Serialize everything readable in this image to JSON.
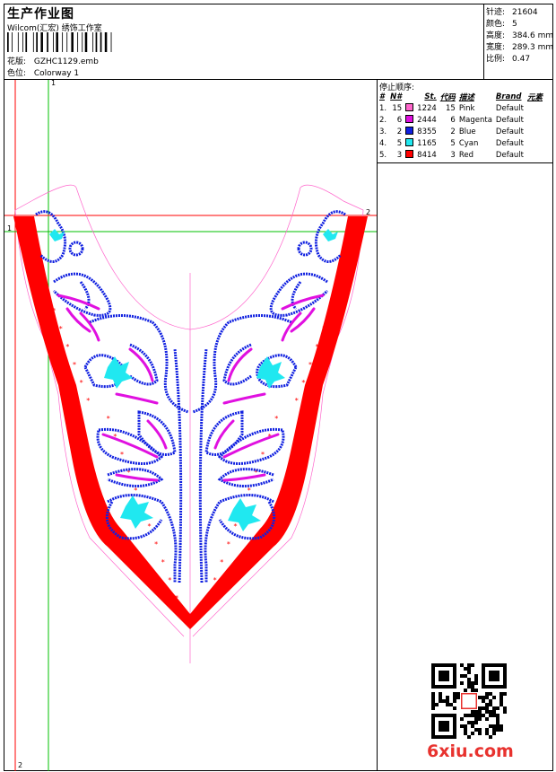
{
  "header": {
    "title": "生产作业图",
    "company": "Wilcom(汇宏) 绣饰工作室",
    "design_label": "花版:",
    "design_value": "GZHC1129.emb",
    "colorway_label": "色位:",
    "colorway_value": "Colorway 1"
  },
  "stats": [
    {
      "label": "针迹:",
      "value": "21604"
    },
    {
      "label": "颜色:",
      "value": "5"
    },
    {
      "label": "高度:",
      "value": "384.6 mm"
    },
    {
      "label": "宽度:",
      "value": "289.3 mm"
    },
    {
      "label": "比例:",
      "value": "0.47"
    }
  ],
  "color_sequence": {
    "title": "停止顺序:",
    "headers": [
      "#",
      "N#",
      "St.",
      "代码",
      "描述",
      "Brand",
      "元素"
    ],
    "rows": [
      {
        "idx": "1.",
        "n": "15",
        "color": "#ff66cc",
        "st": "1224",
        "code": "15",
        "desc": "Pink",
        "brand": "Default"
      },
      {
        "idx": "2.",
        "n": "6",
        "color": "#e010e0",
        "st": "2444",
        "code": "6",
        "desc": "Magenta",
        "brand": "Default"
      },
      {
        "idx": "3.",
        "n": "2",
        "color": "#1020e0",
        "st": "8355",
        "code": "2",
        "desc": "Blue",
        "brand": "Default"
      },
      {
        "idx": "4.",
        "n": "5",
        "color": "#20e8f0",
        "st": "1165",
        "code": "5",
        "desc": "Cyan",
        "brand": "Default"
      },
      {
        "idx": "5.",
        "n": "3",
        "color": "#ff0000",
        "st": "8414",
        "code": "3",
        "desc": "Red",
        "brand": "Default"
      }
    ]
  },
  "guides": {
    "g1": "1",
    "g2": "2",
    "g3": "1",
    "g4": "2"
  },
  "colors": {
    "pink": "#ff66cc",
    "magenta": "#e010e0",
    "blue": "#1020e0",
    "cyan": "#20e8f0",
    "red": "#ff0000",
    "guide_green": "#00c000",
    "guide_red": "#ff0000"
  },
  "watermark": {
    "text": "6xiu.com"
  }
}
